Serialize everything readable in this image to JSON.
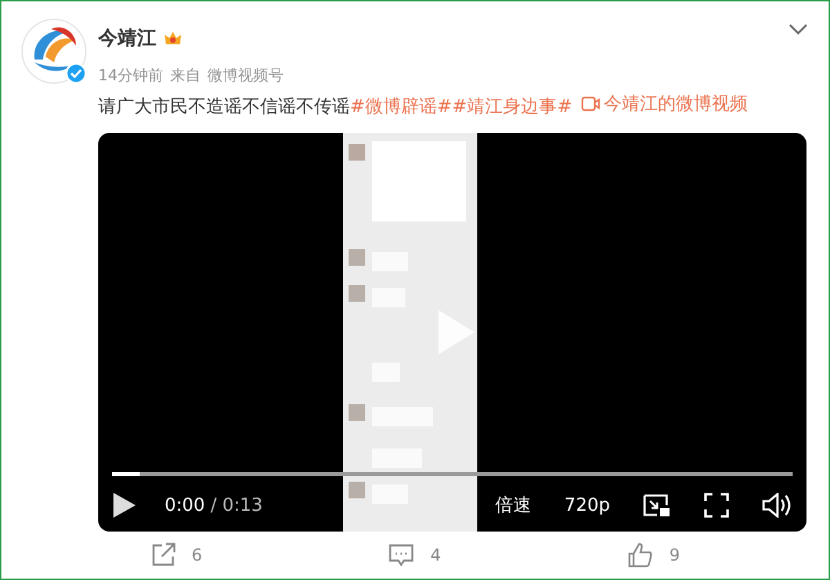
{
  "post": {
    "author": "今靖江",
    "time": "14分钟前",
    "source_prefix": "来自",
    "source": "微博视频号",
    "text_parts": [
      {
        "kind": "plain",
        "text": "请广大市民不造谣不信谣不传谣"
      },
      {
        "kind": "topic",
        "text": "#微博辟谣#"
      },
      {
        "kind": "topic",
        "text": "#靖江身边事#"
      },
      {
        "kind": "video-link",
        "text": "今靖江的微博视频"
      }
    ]
  },
  "video": {
    "progress": {
      "level": 0.04
    },
    "time": "0:00",
    "duration": "/ 0:13",
    "speed": "倍速",
    "quality": "720p"
  },
  "actions": [
    {
      "kind": "share",
      "count": "6"
    },
    {
      "kind": "comment",
      "count": "4"
    },
    {
      "kind": "like",
      "count": "9"
    }
  ]
}
